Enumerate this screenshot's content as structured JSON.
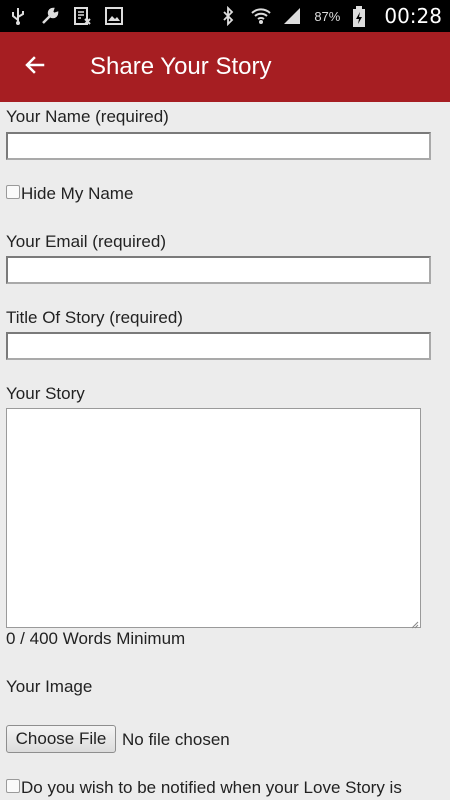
{
  "status_bar": {
    "battery_percent": "87%",
    "time": "00:28",
    "icons": [
      "usb-icon",
      "wrench-icon",
      "sim-icon",
      "image-icon",
      "bluetooth-icon",
      "wifi-icon",
      "signal-icon",
      "battery-charging-icon"
    ]
  },
  "app_bar": {
    "title": "Share Your Story",
    "back_icon": "arrow-left-icon",
    "color": "#a61e22"
  },
  "form": {
    "name_label": "Your Name (required)",
    "name_value": "",
    "hide_name_label": "Hide My Name",
    "hide_name_checked": false,
    "email_label": "Your Email (required)",
    "email_value": "",
    "title_label": "Title Of Story (required)",
    "title_value": "",
    "story_label": "Your Story",
    "story_value": "",
    "word_count": "0 / 400 Words Minimum",
    "image_label": "Your Image",
    "choose_file_label": "Choose File",
    "file_status": "No file chosen",
    "notify_label": "Do you wish to be notified when your Love Story is",
    "notify_checked": false
  }
}
